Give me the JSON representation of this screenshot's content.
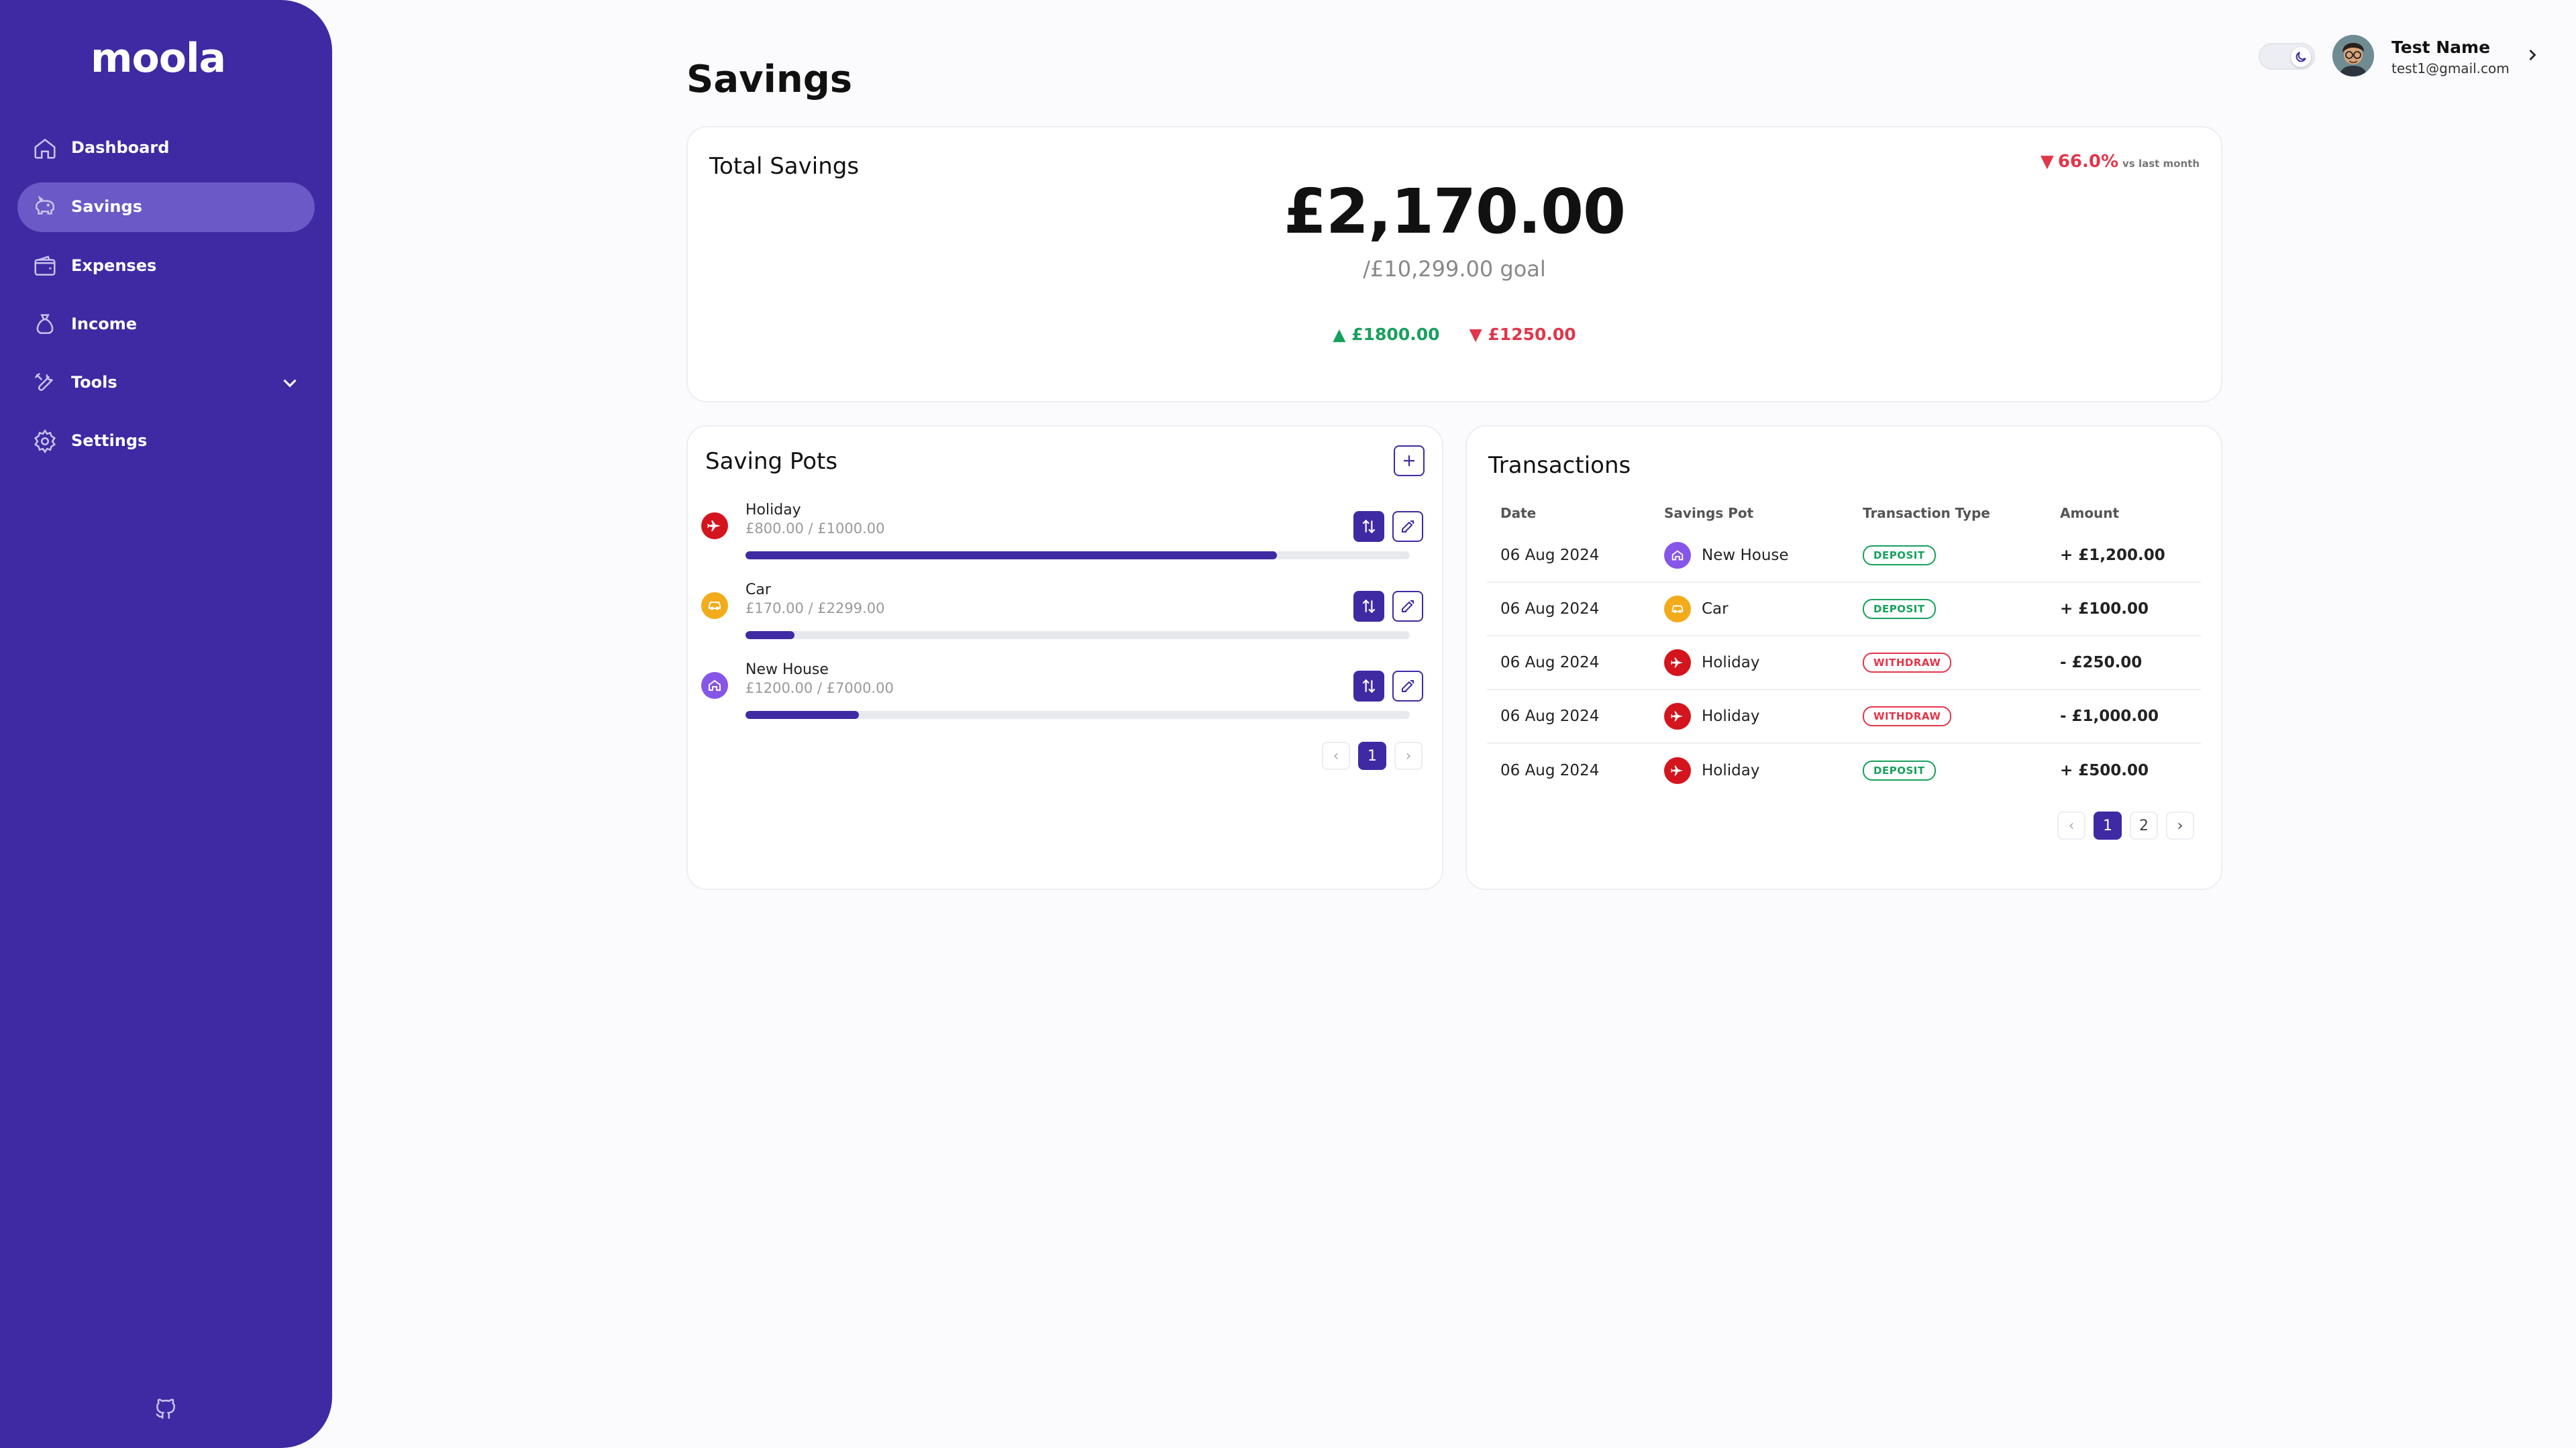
{
  "sidebar": {
    "logo": "moola",
    "items": [
      {
        "label": "Dashboard"
      },
      {
        "label": "Savings"
      },
      {
        "label": "Expenses"
      },
      {
        "label": "Income"
      },
      {
        "label": "Tools"
      },
      {
        "label": "Settings"
      }
    ]
  },
  "header": {
    "title": "Savings",
    "user_name": "Test Name",
    "user_email": "test1@gmail.com"
  },
  "total_savings": {
    "title": "Total Savings",
    "trend_value": "66.0%",
    "trend_label": "vs last month",
    "amount": "£2,170.00",
    "goal": "/£10,299.00 goal",
    "in_amount": "£1800.00",
    "out_amount": "£1250.00"
  },
  "saving_pots": {
    "title": "Saving Pots",
    "pots": [
      {
        "name": "Holiday",
        "amounts": "£800.00 / £1000.00",
        "progress": 0.8,
        "color": "#d4151e",
        "icon": "plane-icon"
      },
      {
        "name": "Car",
        "amounts": "£170.00 / £2299.00",
        "progress": 0.074,
        "color": "#f2ac1b",
        "icon": "car-icon"
      },
      {
        "name": "New House",
        "amounts": "£1200.00 / £7000.00",
        "progress": 0.171,
        "color": "#8656e8",
        "icon": "house-icon"
      }
    ],
    "page": "1"
  },
  "transactions": {
    "title": "Transactions",
    "columns": [
      "Date",
      "Savings Pot",
      "Transaction Type",
      "Amount"
    ],
    "rows": [
      {
        "date": "06 Aug 2024",
        "pot": "New House",
        "type": "DEPOSIT",
        "amount": "+ £1,200.00"
      },
      {
        "date": "06 Aug 2024",
        "pot": "Car",
        "type": "DEPOSIT",
        "amount": "+ £100.00"
      },
      {
        "date": "06 Aug 2024",
        "pot": "Holiday",
        "type": "WITHDRAW",
        "amount": "- £250.00"
      },
      {
        "date": "06 Aug 2024",
        "pot": "Holiday",
        "type": "WITHDRAW",
        "amount": "- £1,000.00"
      },
      {
        "date": "06 Aug 2024",
        "pot": "Holiday",
        "type": "DEPOSIT",
        "amount": "+ £500.00"
      }
    ],
    "pages": [
      "1",
      "2"
    ]
  },
  "colors": {
    "brand": "#3f2aa3",
    "positive": "#17a05d",
    "negative": "#e2364a"
  }
}
